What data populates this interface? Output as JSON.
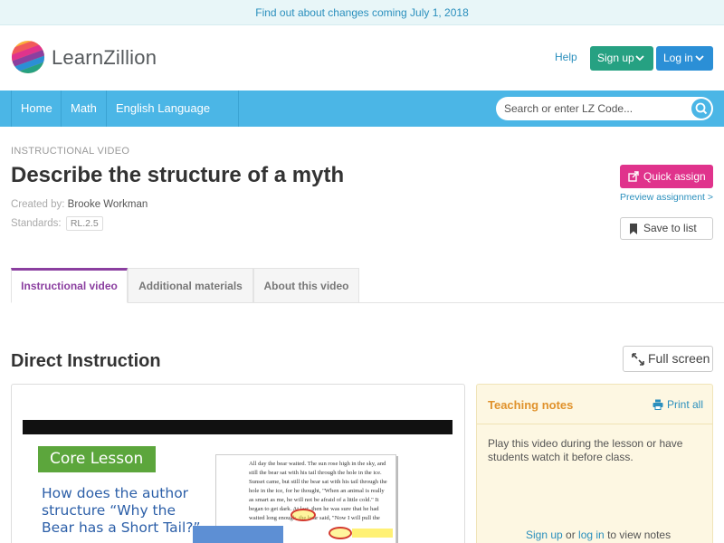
{
  "banner": {
    "text": "Find out about changes coming July 1, 2018"
  },
  "header": {
    "logo_text": "LearnZillion",
    "help_label": "Help",
    "signup_label": "Sign up",
    "login_label": "Log in"
  },
  "nav": {
    "items": [
      {
        "label": "Home"
      },
      {
        "label": "Math"
      },
      {
        "label": "English Language Arts"
      }
    ],
    "search_placeholder": "Search or enter LZ Code..."
  },
  "lesson": {
    "kicker": "INSTRUCTIONAL VIDEO",
    "title": "Describe the structure of a myth",
    "created_by_label": "Created by:",
    "author": "Brooke Workman",
    "standards_label": "Standards:",
    "standard": "RL.2.5"
  },
  "actions": {
    "quick_assign_label": "Quick assign",
    "preview_label": "Preview assignment >",
    "save_label": "Save to list"
  },
  "tabs": [
    {
      "label": "Instructional video",
      "active": true
    },
    {
      "label": "Additional materials",
      "active": false
    },
    {
      "label": "About this video",
      "active": false
    }
  ],
  "section": {
    "title": "Direct Instruction",
    "fullscreen_label": "Full screen"
  },
  "video": {
    "slide_tag": "Core Lesson",
    "slide_question": "How does the author structure “Why the Bear has a Short Tail?”",
    "passage": "All day the bear waited. The sun rose high in the sky, and still the bear sat with his tail through the hole in the ice. Sunset came, but still the bear sat with his tail through the hole in the ice, for he thought, \"When an animal is really as smart as me, he will not be afraid of a little cold.\" It began to get dark. At last, then he was sure that he had waited long enough, the bear said, \"Now I will pull the"
  },
  "notes": {
    "title": "Teaching notes",
    "print_label": "Print all",
    "body": "Play this video during the lesson or have students watch it before class.",
    "signup_link": "Sign up",
    "or_text": " or ",
    "login_link": "log in",
    "suffix": " to view notes"
  },
  "colors": {
    "nav_blue": "#4bb6e6",
    "signup_green": "#26a182",
    "login_blue": "#2b8fd6",
    "quick_assign_pink": "#e0338c",
    "tab_active_purple": "#8b3fa0",
    "notes_orange": "#e0922c"
  }
}
